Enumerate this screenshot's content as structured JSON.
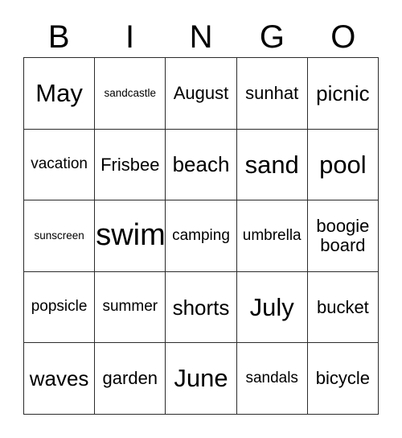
{
  "card": {
    "header_letters": [
      "B",
      "I",
      "N",
      "G",
      "O"
    ],
    "grid": {
      "rows": 5,
      "columns": 5,
      "border_color": "#2b2b2b",
      "background_color": "#ffffff",
      "text_color": "#000000"
    },
    "cells": [
      {
        "text": "May",
        "size": "fs-xxl"
      },
      {
        "text": "sandcastle",
        "size": "fs-xs"
      },
      {
        "text": "August",
        "size": "fs-l"
      },
      {
        "text": "sunhat",
        "size": "fs-l"
      },
      {
        "text": "picnic",
        "size": "fs-xl"
      },
      {
        "text": "vacation",
        "size": "fs-m"
      },
      {
        "text": "Frisbee",
        "size": "fs-l"
      },
      {
        "text": "beach",
        "size": "fs-xl"
      },
      {
        "text": "sand",
        "size": "fs-xxl"
      },
      {
        "text": "pool",
        "size": "fs-xxl"
      },
      {
        "text": "sunscreen",
        "size": "fs-xs"
      },
      {
        "text": "swim",
        "size": "fs-huge"
      },
      {
        "text": "camping",
        "size": "fs-m"
      },
      {
        "text": "umbrella",
        "size": "fs-m"
      },
      {
        "text": "boogie\nboard",
        "size": "fs-l"
      },
      {
        "text": "popsicle",
        "size": "fs-m"
      },
      {
        "text": "summer",
        "size": "fs-m"
      },
      {
        "text": "shorts",
        "size": "fs-xl"
      },
      {
        "text": "July",
        "size": "fs-xxl"
      },
      {
        "text": "bucket",
        "size": "fs-l"
      },
      {
        "text": "waves",
        "size": "fs-xl"
      },
      {
        "text": "garden",
        "size": "fs-l"
      },
      {
        "text": "June",
        "size": "fs-xxl"
      },
      {
        "text": "sandals",
        "size": "fs-m"
      },
      {
        "text": "bicycle",
        "size": "fs-l"
      }
    ]
  }
}
